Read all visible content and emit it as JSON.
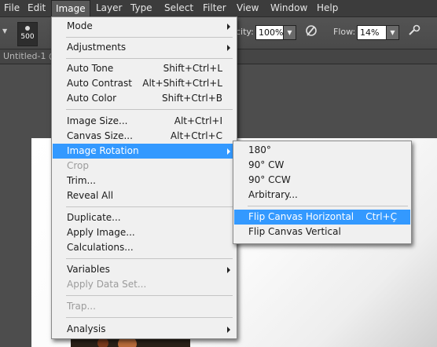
{
  "menubar": {
    "items": [
      "File",
      "Edit",
      "Image",
      "Layer",
      "Type",
      "Select",
      "Filter",
      "View",
      "Window",
      "Help"
    ]
  },
  "options_bar": {
    "brush_size": "500",
    "opacity_label": "city:",
    "opacity_value": "100%",
    "flow_label": "Flow:",
    "flow_value": "14%",
    "icons": [
      "brush-preset-icon",
      "airbrush-icon",
      "pressure-opacity-icon",
      "pressure-size-icon"
    ]
  },
  "document": {
    "tab_title": "Untitled-1 @"
  },
  "image_menu": {
    "items": [
      {
        "label": "Mode",
        "shortcut": "",
        "submenu": true,
        "disabled": false
      },
      {
        "label": "Adjustments",
        "shortcut": "",
        "submenu": true,
        "disabled": false
      },
      {
        "label": "Auto Tone",
        "shortcut": "Shift+Ctrl+L",
        "submenu": false,
        "disabled": false
      },
      {
        "label": "Auto Contrast",
        "shortcut": "Alt+Shift+Ctrl+L",
        "submenu": false,
        "disabled": false
      },
      {
        "label": "Auto Color",
        "shortcut": "Shift+Ctrl+B",
        "submenu": false,
        "disabled": false
      },
      {
        "label": "Image Size...",
        "shortcut": "Alt+Ctrl+I",
        "submenu": false,
        "disabled": false
      },
      {
        "label": "Canvas Size...",
        "shortcut": "Alt+Ctrl+C",
        "submenu": false,
        "disabled": false
      },
      {
        "label": "Image Rotation",
        "shortcut": "",
        "submenu": true,
        "disabled": false,
        "highlight": true
      },
      {
        "label": "Crop",
        "shortcut": "",
        "submenu": false,
        "disabled": true
      },
      {
        "label": "Trim...",
        "shortcut": "",
        "submenu": false,
        "disabled": false
      },
      {
        "label": "Reveal All",
        "shortcut": "",
        "submenu": false,
        "disabled": false
      },
      {
        "label": "Duplicate...",
        "shortcut": "",
        "submenu": false,
        "disabled": false
      },
      {
        "label": "Apply Image...",
        "shortcut": "",
        "submenu": false,
        "disabled": false
      },
      {
        "label": "Calculations...",
        "shortcut": "",
        "submenu": false,
        "disabled": false
      },
      {
        "label": "Variables",
        "shortcut": "",
        "submenu": true,
        "disabled": false
      },
      {
        "label": "Apply Data Set...",
        "shortcut": "",
        "submenu": false,
        "disabled": true
      },
      {
        "label": "Trap...",
        "shortcut": "",
        "submenu": false,
        "disabled": true
      },
      {
        "label": "Analysis",
        "shortcut": "",
        "submenu": true,
        "disabled": false
      }
    ]
  },
  "rotation_submenu": {
    "items": [
      {
        "label": "180°",
        "shortcut": ""
      },
      {
        "label": "90° CW",
        "shortcut": ""
      },
      {
        "label": "90° CCW",
        "shortcut": ""
      },
      {
        "label": "Arbitrary...",
        "shortcut": ""
      },
      {
        "label": "Flip Canvas Horizontal",
        "shortcut": "Ctrl+Ç",
        "highlight": true
      },
      {
        "label": "Flip Canvas Vertical",
        "shortcut": ""
      }
    ]
  },
  "colors": {
    "menu_highlight": "#3399ff",
    "menu_background": "#f0f0f0",
    "app_background": "#3b3b3b"
  }
}
